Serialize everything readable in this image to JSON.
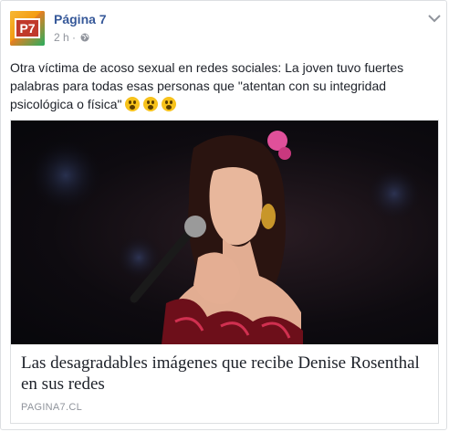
{
  "post": {
    "page_name": "Página 7",
    "avatar_text": "P7",
    "time": "2 h",
    "separator": "·",
    "text": "Otra víctima de acoso sexual en redes sociales: La joven tuvo fuertes palabras para todas esas personas que \"atentan con su integridad psicológica o física\"",
    "emojis": [
      "astonished-emoji",
      "astonished-emoji",
      "astonished-emoji"
    ],
    "privacy_icon": "globe-icon",
    "menu_icon": "chevron-down-icon"
  },
  "link": {
    "title": "Las desagradables imágenes que recibe Denise Rosenthal en sus redes",
    "domain": "PAGINA7.CL"
  },
  "colors": {
    "link_blue": "#365899",
    "meta_gray": "#90949c",
    "text": "#1d2129",
    "border": "#dddfe2"
  }
}
